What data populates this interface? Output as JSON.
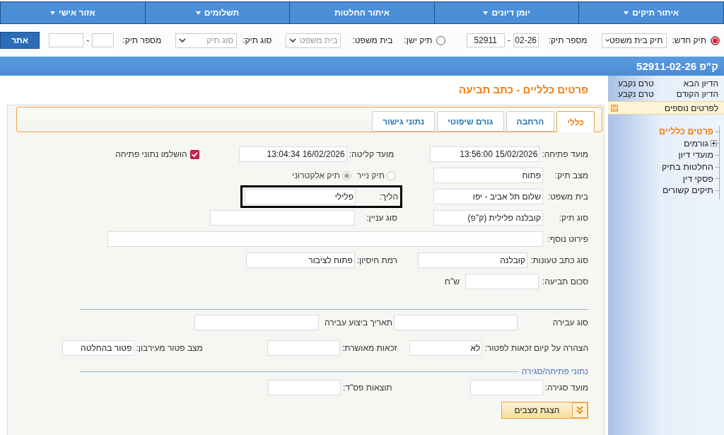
{
  "nav": [
    {
      "label": "איתור תיקים",
      "dropdown": true
    },
    {
      "label": "יומן דיונים",
      "dropdown": true
    },
    {
      "label": "איתור החלטות",
      "dropdown": false
    },
    {
      "label": "תשלומים",
      "dropdown": true
    },
    {
      "label": "אזור אישי",
      "dropdown": true
    }
  ],
  "search": {
    "new_case": {
      "label": "תיק חדש:",
      "selected": true
    },
    "case_type_select": "תיק בית משפט",
    "number_label": "מספר תיק:",
    "number_part_1": "02-26",
    "separator": "-",
    "number_part_2": "52911",
    "old_case": {
      "label": "תיק ישן:",
      "selected": false
    },
    "court_label": "בית משפט:",
    "court_placeholder": "בית משפט",
    "type_label": "סוג תיק:",
    "type_placeholder": "סוג תיק",
    "old_number_label": "מספר תיק:",
    "old_separator": "-",
    "submit": "אתר"
  },
  "case_title": "ק\"פ 52911-02-26",
  "sidebar": {
    "hearings": [
      {
        "label": "הדיון הבא",
        "value": "טרם נקבע"
      },
      {
        "label": "הדיון הקודם",
        "value": "טרם נקבע"
      }
    ],
    "more_details": "לפרטים נוספים",
    "tree": [
      {
        "label": "פרטים כלליים",
        "selected": true
      },
      {
        "label": "גורמים",
        "selected": false,
        "expanded": false
      },
      {
        "label": "מועדי דיון",
        "selected": false
      },
      {
        "label": "החלטות בתיק",
        "selected": false
      },
      {
        "label": "פסקי דין",
        "selected": false
      },
      {
        "label": "תיקים קשורים",
        "selected": false
      }
    ]
  },
  "page_title": "פרטים כלליים - כתב תביעה",
  "tabs": [
    {
      "label": "כללי",
      "selected": true
    },
    {
      "label": "הרחבה",
      "selected": false
    },
    {
      "label": "גורם שיפוטי",
      "selected": false
    },
    {
      "label": "נתוני גישור",
      "selected": false
    }
  ],
  "sections": [
    {
      "rows": [
        [
          {
            "kind": "field",
            "label": "מועד פתיחה:",
            "value": "15/02/2026 13:56:00"
          },
          {
            "kind": "field",
            "label": "מועד קליטה:",
            "value": "16/02/2026 13:04:34"
          },
          {
            "kind": "checkbox",
            "label": "הושלמו נתוני פתיחה",
            "checked": true
          }
        ],
        [
          {
            "kind": "field",
            "label": "מצב תיק:",
            "value": "פתוח"
          },
          {
            "kind": "radios",
            "disabled": true,
            "options": [
              {
                "label": "תיק נייר",
                "selected": false
              },
              {
                "label": "תיק אלקטרוני",
                "selected": true
              }
            ]
          }
        ],
        [
          {
            "kind": "field",
            "label": "בית משפט:",
            "value": "שלום תל אביב - יפו"
          },
          {
            "kind": "field",
            "label": "הליך:",
            "value": "פלילי",
            "highlighted": true
          }
        ],
        [
          {
            "kind": "field",
            "label": "סוג תיק:",
            "value": "קובלנה פלילית (ק\"פ)"
          },
          {
            "kind": "field",
            "label": "סוג עניין:"
          }
        ],
        [
          {
            "kind": "field",
            "label": "פירוט נוסף:"
          }
        ],
        [
          {
            "kind": "field",
            "label": "סוג כתב טעונות:",
            "value": "קובלנה"
          },
          {
            "kind": "field",
            "label": "רמת חיסיון:",
            "value": "פתוח לציבור"
          }
        ],
        [
          {
            "kind": "field",
            "label": "סכום תביעה:",
            "unit": "ש\"ח"
          }
        ]
      ]
    },
    {
      "rows": [
        [
          {
            "kind": "field",
            "label": "סוג עבירה"
          },
          {
            "kind": "field",
            "label": "תאריך ביצוע עבירה"
          }
        ],
        [
          {
            "kind": "field",
            "label": "הצהרה על קיום זכאות לפטור:",
            "value": "לא"
          },
          {
            "kind": "field",
            "label": "זכאות מאושרת:"
          },
          {
            "kind": "field",
            "label": "מצב פטור מעירבון:",
            "value": "פטור בהחלטה"
          }
        ]
      ]
    },
    {
      "title": "נתוני פתיחה/סגירה",
      "rows": [
        [
          {
            "kind": "field",
            "label": "מועד סגירה:"
          },
          {
            "kind": "field",
            "label": "תוצאות פס\"ד:"
          }
        ]
      ]
    }
  ],
  "show_states_button": "הצגת מצבים"
}
